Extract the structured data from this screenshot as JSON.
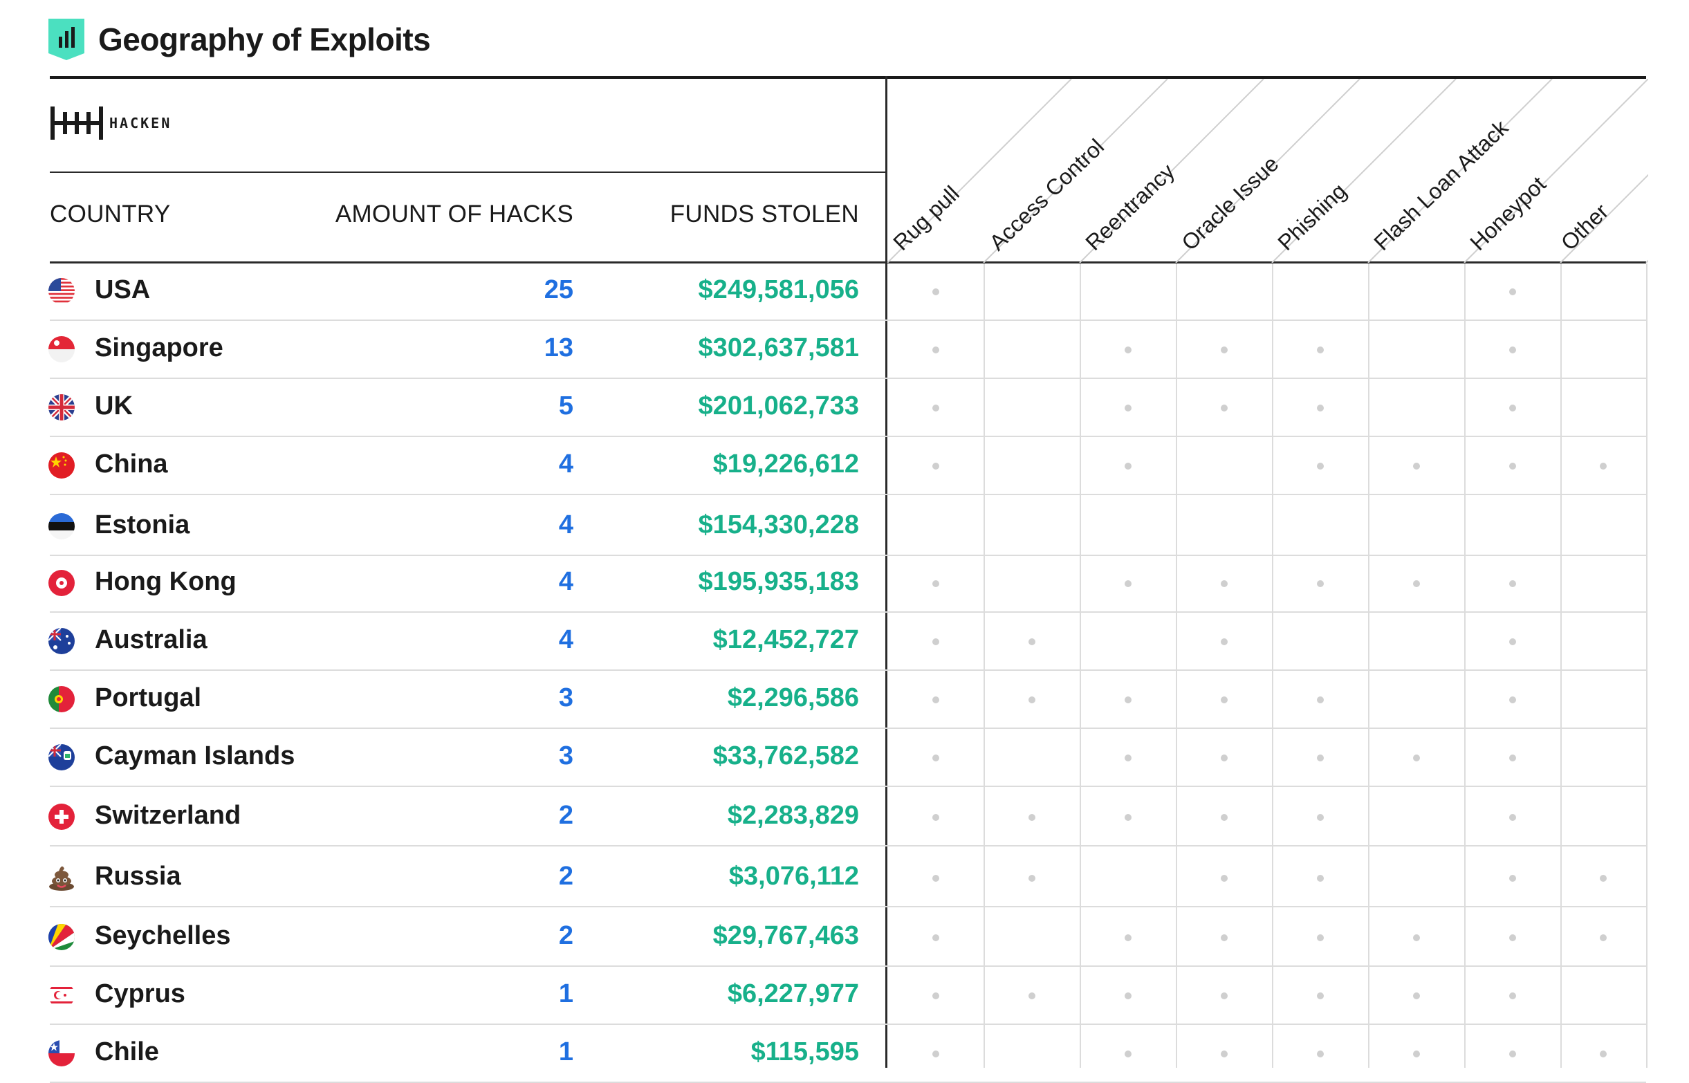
{
  "title": "Geography of Exploits",
  "brand": "HACKEN",
  "colors": {
    "accent_badge": "#4be0c0",
    "hacks_blue": "#1f6fe0",
    "funds_green": "#17b08a",
    "dot_gray": "#cfcfcf"
  },
  "chart_data": {
    "type": "table",
    "title": "Geography of Exploits",
    "columns": {
      "country": "COUNTRY",
      "hacks": "AMOUNT OF HACKS",
      "funds": "FUNDS STOLEN"
    },
    "attack_types": [
      "Rug pull",
      "Access Control",
      "Reentrancy",
      "Oracle Issue",
      "Phishing",
      "Flash Loan Attack",
      "Honeypot",
      "Other"
    ],
    "rows": [
      {
        "country": "USA",
        "flag": "usa",
        "hacks": "25",
        "funds": "$249,581,056",
        "types": [
          1,
          0,
          0,
          0,
          0,
          0,
          1,
          0
        ]
      },
      {
        "country": "Singapore",
        "flag": "singapore",
        "hacks": "13",
        "funds": "$302,637,581",
        "types": [
          1,
          0,
          1,
          1,
          1,
          0,
          1,
          0
        ]
      },
      {
        "country": "UK",
        "flag": "uk",
        "hacks": "5",
        "funds": "$201,062,733",
        "types": [
          1,
          0,
          1,
          1,
          1,
          0,
          1,
          0
        ]
      },
      {
        "country": "China",
        "flag": "china",
        "hacks": "4",
        "funds": "$19,226,612",
        "types": [
          1,
          0,
          1,
          0,
          1,
          1,
          1,
          1
        ]
      },
      {
        "country": "Estonia",
        "flag": "estonia",
        "hacks": "4",
        "funds": "$154,330,228",
        "types": [
          0,
          0,
          0,
          0,
          0,
          0,
          0,
          0
        ]
      },
      {
        "country": "Hong Kong",
        "flag": "hongkong",
        "hacks": "4",
        "funds": "$195,935,183",
        "types": [
          1,
          0,
          1,
          1,
          1,
          1,
          1,
          0
        ]
      },
      {
        "country": "Australia",
        "flag": "australia",
        "hacks": "4",
        "funds": "$12,452,727",
        "types": [
          1,
          1,
          0,
          1,
          0,
          0,
          1,
          0
        ]
      },
      {
        "country": "Portugal",
        "flag": "portugal",
        "hacks": "3",
        "funds": "$2,296,586",
        "types": [
          1,
          1,
          1,
          1,
          1,
          0,
          1,
          0
        ]
      },
      {
        "country": "Cayman Islands",
        "flag": "cayman",
        "hacks": "3",
        "funds": "$33,762,582",
        "types": [
          1,
          0,
          1,
          1,
          1,
          1,
          1,
          0
        ]
      },
      {
        "country": "Switzerland",
        "flag": "switzerland",
        "hacks": "2",
        "funds": "$2,283,829",
        "types": [
          1,
          1,
          1,
          1,
          1,
          0,
          1,
          0
        ]
      },
      {
        "country": "Russia",
        "flag": "russia",
        "hacks": "2",
        "funds": "$3,076,112",
        "types": [
          1,
          1,
          0,
          1,
          1,
          0,
          1,
          1
        ]
      },
      {
        "country": "Seychelles",
        "flag": "seychelles",
        "hacks": "2",
        "funds": "$29,767,463",
        "types": [
          1,
          0,
          1,
          1,
          1,
          1,
          1,
          1
        ]
      },
      {
        "country": "Cyprus",
        "flag": "cyprus",
        "hacks": "1",
        "funds": "$6,227,977",
        "types": [
          1,
          1,
          1,
          1,
          1,
          1,
          1,
          0
        ]
      },
      {
        "country": "Chile",
        "flag": "chile",
        "hacks": "1",
        "funds": "$115,595",
        "types": [
          1,
          0,
          1,
          1,
          1,
          1,
          1,
          1
        ]
      }
    ]
  }
}
